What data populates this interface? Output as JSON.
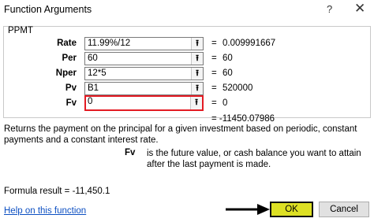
{
  "window": {
    "title": "Function Arguments",
    "help_label": "?",
    "close_label": "✕"
  },
  "function_name": "PPMT",
  "arguments": [
    {
      "label": "Rate",
      "value": "11.99%/12",
      "evaluated": "0.009991667"
    },
    {
      "label": "Per",
      "value": "60",
      "evaluated": "60"
    },
    {
      "label": "Nper",
      "value": "12*5",
      "evaluated": "60"
    },
    {
      "label": "Pv",
      "value": "B1",
      "evaluated": "520000"
    },
    {
      "label": "Fv",
      "value": "0",
      "evaluated": "0"
    }
  ],
  "equals_sign": "=",
  "result_preview": "= -11450.07986",
  "description": "Returns the payment on the principal for a given investment based on periodic, constant payments and a constant interest rate.",
  "arg_help": {
    "name": "Fv",
    "text": "is the future value, or cash balance you want to attain after the last payment is made."
  },
  "formula_result": "Formula result =   -11,450.1",
  "help_link": "Help on this function",
  "buttons": {
    "ok": "OK",
    "cancel": "Cancel"
  },
  "icons": {
    "collapse": "collapse-dialog-icon",
    "pointer": "arrow-pointer-icon"
  },
  "colors": {
    "active_input_border": "#e31b23",
    "ok_highlight": "#dde024",
    "link": "#0c4fc2"
  }
}
